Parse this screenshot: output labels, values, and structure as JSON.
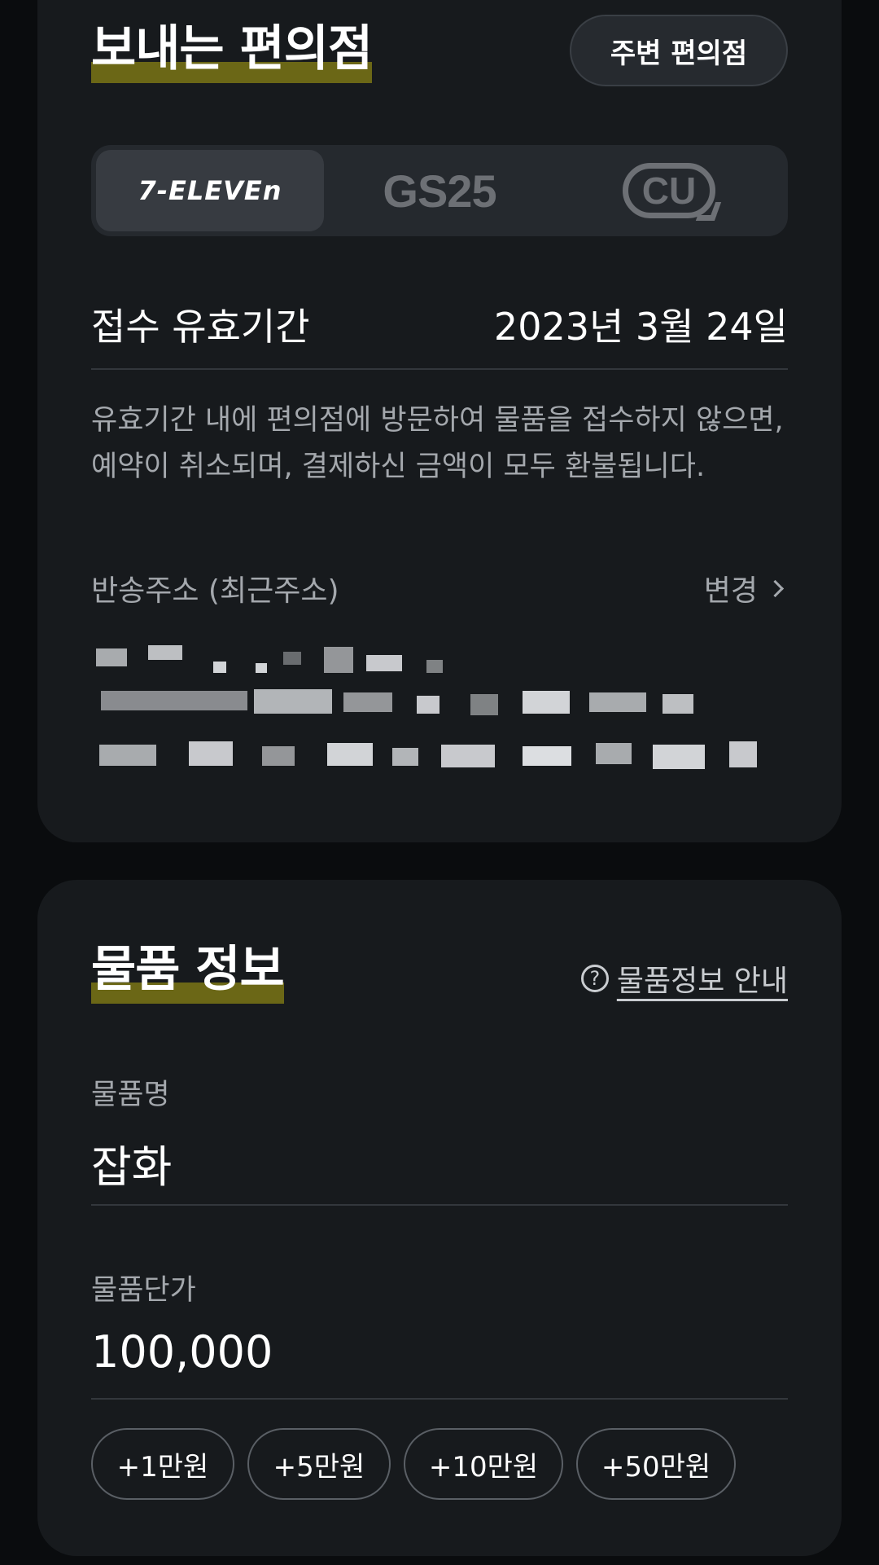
{
  "store_section": {
    "title": "보내는 편의점",
    "nearby_button": "주변 편의점",
    "stores": [
      {
        "label": "7-ELEVEn",
        "selected": true
      },
      {
        "label": "GS25",
        "selected": false
      },
      {
        "label": "CU",
        "selected": false
      }
    ],
    "validity_label": "접수 유효기간",
    "validity_date": "2023년 3월 24일",
    "note_line1": "유효기간 내에 편의점에 방문하여 물품을 접수하지 않으면,",
    "note_line2": "예약이 취소되며, 결제하신 금액이 모두 환불됩니다.",
    "return_address_label": "반송주소 (최근주소)",
    "change_label": "변경"
  },
  "item_section": {
    "title": "물품 정보",
    "guide_link": "물품정보 안내",
    "name_label": "물품명",
    "name_value": "잡화",
    "price_label": "물품단가",
    "price_value": "100,000",
    "quick_amounts": [
      "+1만원",
      "+5만원",
      "+10만원",
      "+50만원"
    ]
  },
  "colors": {
    "accent_highlight": "#6b6716",
    "card_background": "#171a1d",
    "page_background": "#0a0c0e"
  }
}
